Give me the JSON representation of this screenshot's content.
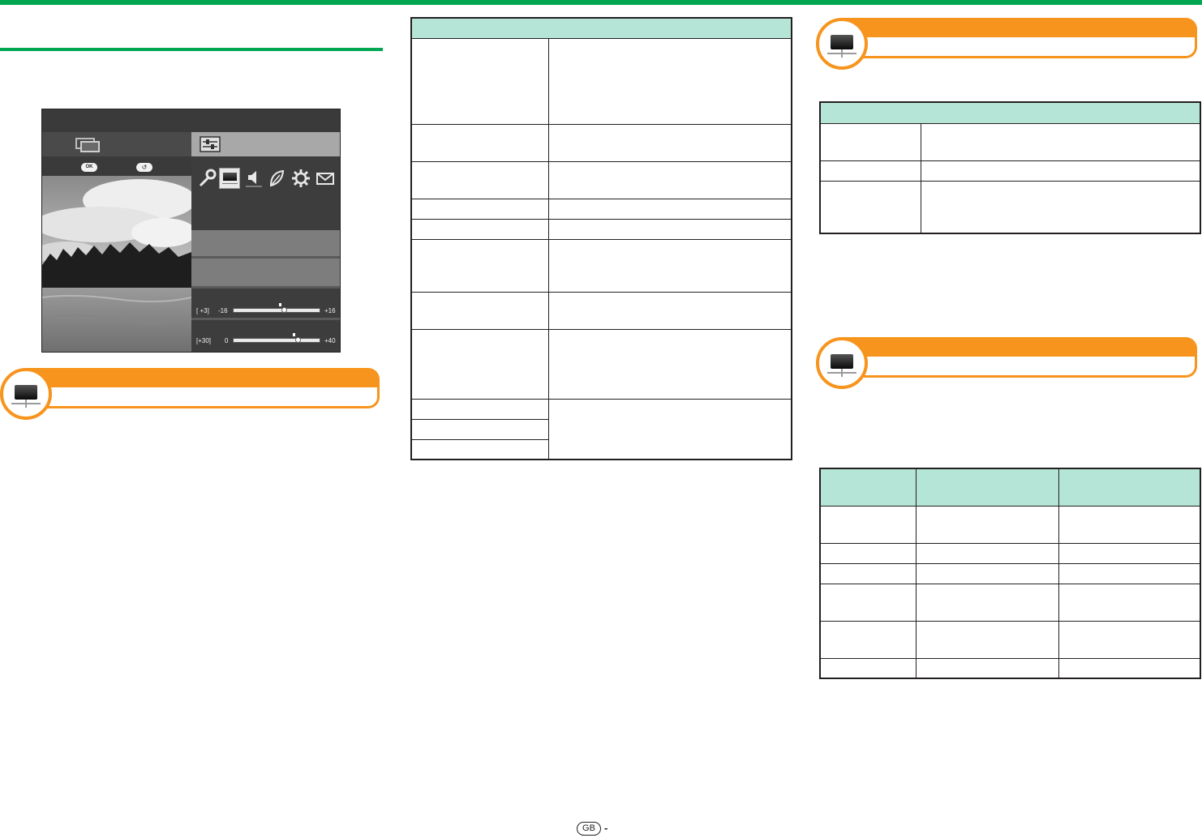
{
  "page": {
    "accent_color": "#00a651",
    "banner_color": "#f7941d",
    "table_header_color": "#b5e5d6"
  },
  "screen": {
    "ok_button_label": "OK",
    "back_button_label": "↺",
    "icons": [
      "wrench-icon",
      "picture-icon",
      "speaker-icon",
      "leaf-icon",
      "gear-icon",
      "envelope-icon"
    ],
    "selected_icon": "picture-icon",
    "slider1": {
      "value_label": "[  +3]",
      "min_label": "-16",
      "max_label": "+16",
      "value": 3,
      "min": -16,
      "max": 16
    },
    "slider2": {
      "value_label": "[+30]",
      "min_label": "0",
      "max_label": "+40",
      "value": 30,
      "min": 0,
      "max": 40
    }
  },
  "footer": {
    "region_label": "GB",
    "dash": "-"
  }
}
